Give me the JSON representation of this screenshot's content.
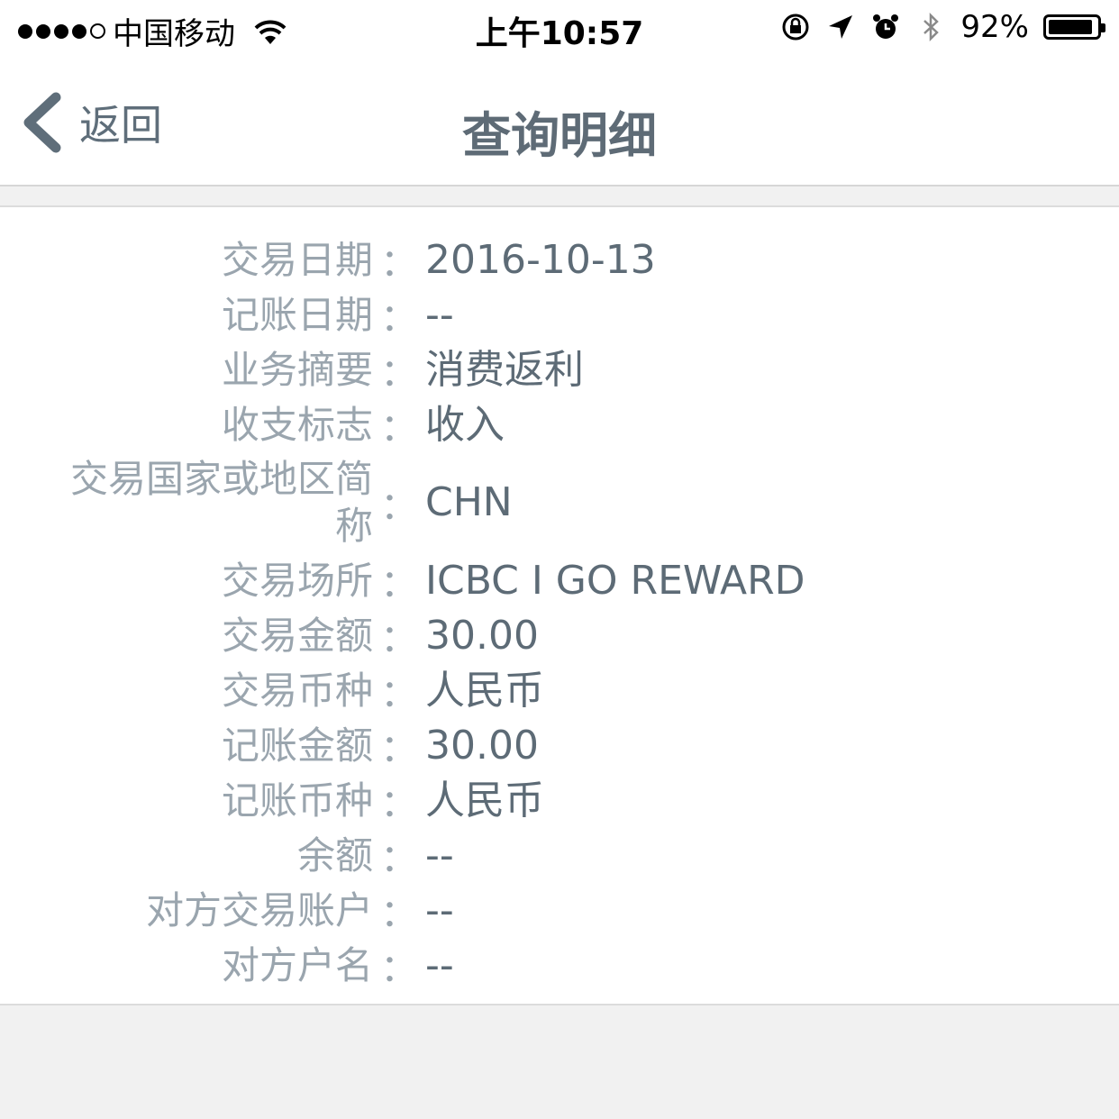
{
  "status_bar": {
    "carrier": "中国移动",
    "time": "上午10:57",
    "battery_percent": "92%",
    "battery_level": 0.92,
    "signal_bars_filled": 4,
    "signal_bars_total": 5
  },
  "nav": {
    "back_label": "返回",
    "title": "查询明细"
  },
  "details": [
    {
      "label": "交易日期",
      "value": "2016-10-13"
    },
    {
      "label": "记账日期",
      "value": "--"
    },
    {
      "label": "业务摘要",
      "value": "消费返利"
    },
    {
      "label": "收支标志",
      "value": "收入"
    },
    {
      "label": "交易国家或地区简称",
      "value": "CHN"
    },
    {
      "label": "交易场所",
      "value": "ICBC I GO REWARD"
    },
    {
      "label": "交易金额",
      "value": "30.00"
    },
    {
      "label": "交易币种",
      "value": "人民币"
    },
    {
      "label": "记账金额",
      "value": "30.00"
    },
    {
      "label": "记账币种",
      "value": "人民币"
    },
    {
      "label": "余额",
      "value": "--"
    },
    {
      "label": "对方交易账户",
      "value": "--"
    },
    {
      "label": "对方户名",
      "value": "--"
    }
  ],
  "colon": "：",
  "colors": {
    "label": "#9aa5ae",
    "value": "#5d6b76",
    "title": "#5e6b76",
    "background": "#f1f1f1"
  }
}
